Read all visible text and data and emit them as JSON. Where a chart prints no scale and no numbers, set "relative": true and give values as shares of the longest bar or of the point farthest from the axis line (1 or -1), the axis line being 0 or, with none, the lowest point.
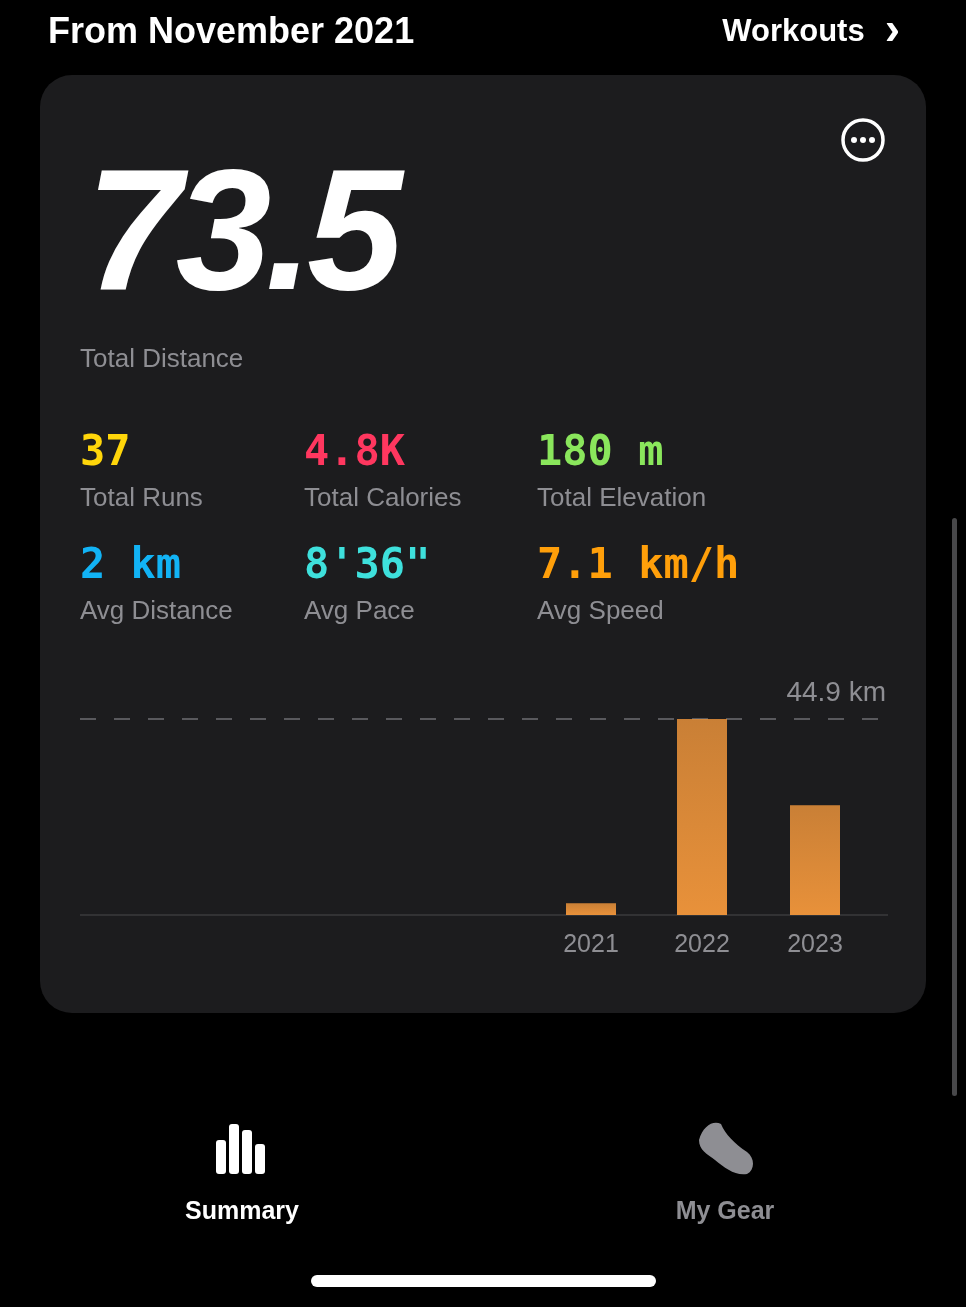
{
  "header": {
    "title": "From November 2021",
    "link": "Workouts",
    "chevron": "›"
  },
  "summary": {
    "total": "73.5",
    "total_label": "Total Distance"
  },
  "stats": [
    {
      "value": "37",
      "label": "Total Runs",
      "color": "#ffd60a"
    },
    {
      "value": "4.8K",
      "label": "Total Calories",
      "color": "#ff375f"
    },
    {
      "value": "180 m",
      "label": "Total Elevation",
      "color": "#8ae65c"
    },
    {
      "value": "2 km",
      "label": "Avg Distance",
      "color": "#12b3f5"
    },
    {
      "value": "8'36\"",
      "label": "Avg Pace",
      "color": "#3ee0dc"
    },
    {
      "value": "7.1 km/h",
      "label": "Avg Speed",
      "color": "#ff9f0a"
    }
  ],
  "chart": {
    "chart_data": {
      "type": "bar",
      "categories": [
        "2021",
        "2022",
        "2023"
      ],
      "series": [
        {
          "color": "#e8913a",
          "values": [
            0.06,
            1,
            0.56
          ]
        }
      ],
      "relative": true,
      "annotations": [
        "44.9 km"
      ]
    }
  },
  "tabs": [
    {
      "label": "Summary",
      "selected": true,
      "kind": "summary"
    },
    {
      "label": "My Gear",
      "selected": false,
      "kind": "gear"
    }
  ]
}
